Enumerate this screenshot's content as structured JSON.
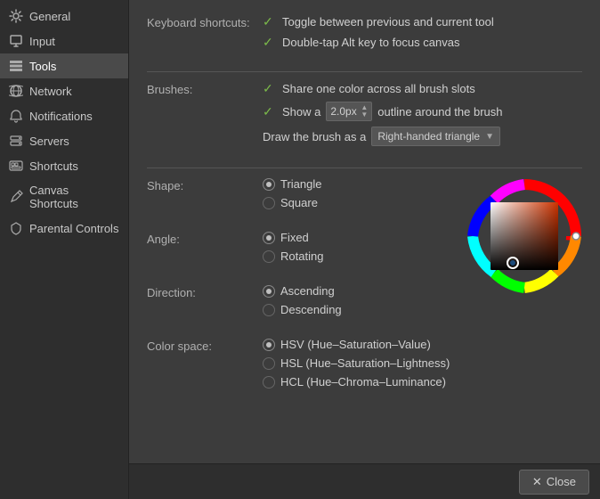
{
  "sidebar": {
    "items": [
      {
        "id": "general",
        "label": "General",
        "icon": "⚙"
      },
      {
        "id": "input",
        "label": "Input",
        "icon": "🖱"
      },
      {
        "id": "tools",
        "label": "Tools",
        "icon": "🔧",
        "active": true
      },
      {
        "id": "network",
        "label": "Network",
        "icon": "🌐"
      },
      {
        "id": "notifications",
        "label": "Notifications",
        "icon": "🔔"
      },
      {
        "id": "servers",
        "label": "Servers",
        "icon": "🖥"
      },
      {
        "id": "shortcuts",
        "label": "Shortcuts",
        "icon": "⌨"
      },
      {
        "id": "canvas-shortcuts",
        "label": "Canvas Shortcuts",
        "icon": "✏"
      },
      {
        "id": "parental-controls",
        "label": "Parental Controls",
        "icon": "🛡"
      }
    ]
  },
  "main": {
    "keyboard_shortcuts": {
      "label": "Keyboard shortcuts:",
      "option1": "Toggle between previous and current tool",
      "option2": "Double-tap Alt key to focus canvas"
    },
    "brushes": {
      "label": "Brushes:",
      "option1": "Share one color across all brush slots",
      "option2_prefix": "Show a",
      "option2_value": "2.0px",
      "option2_suffix": "outline around the brush",
      "option3_prefix": "Draw the brush as a",
      "option3_dropdown": "Right-handed triangle"
    },
    "shape": {
      "label": "Shape:",
      "option1": "Triangle",
      "option2": "Square"
    },
    "angle": {
      "label": "Angle:",
      "option1": "Fixed",
      "option2": "Rotating"
    },
    "direction": {
      "label": "Direction:",
      "option1": "Ascending",
      "option2": "Descending"
    },
    "color_space": {
      "label": "Color space:",
      "option1": "HSV (Hue–Saturation–Value)",
      "option2": "HSL (Hue–Saturation–Lightness)",
      "option3": "HCL (Hue–Chroma–Luminance)"
    }
  },
  "footer": {
    "close_label": "Close"
  }
}
